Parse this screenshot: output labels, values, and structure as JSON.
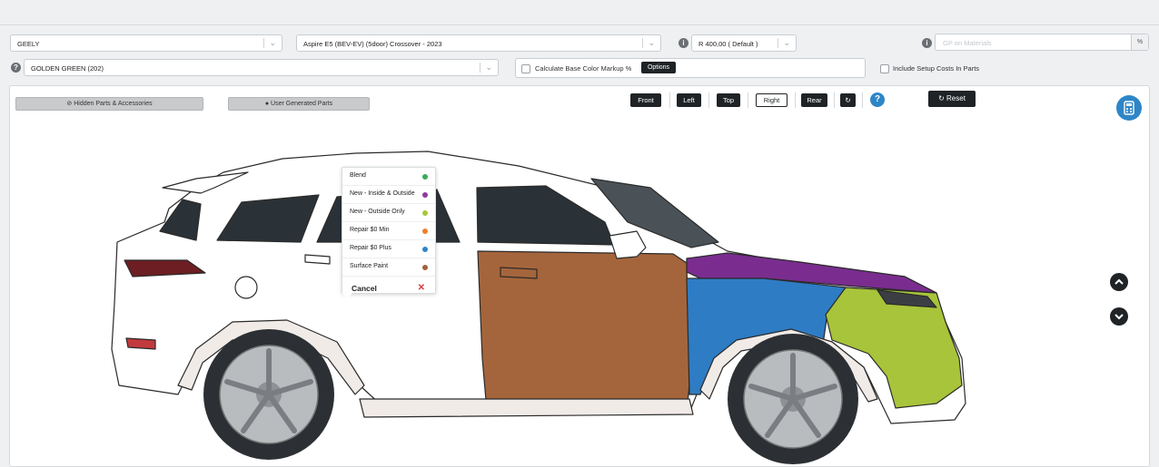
{
  "controls": {
    "make": "GEELY",
    "model": "Aspire E5 (BEV-EV) (5door) Crossover - 2023",
    "rate": "R 400,00 ( Default )",
    "gp_placeholder": "GP on Materials",
    "gp_addon": "%",
    "color": "GOLDEN GREEN (202)",
    "calc_markup_label": "Calculate Base Color Markup %",
    "options_label": "Options",
    "include_setup_label": "Include Setup Costs In Parts",
    "info_glyph": "i",
    "help_glyph": "?"
  },
  "viewer": {
    "hidden_parts_label": "Hidden Parts & Accessories",
    "user_parts_label": "User Generated Parts",
    "views": [
      "Front",
      "Left",
      "Top",
      "Right",
      "Rear"
    ],
    "active_view": "Right",
    "reset_label": "Reset",
    "help_glyph": "?"
  },
  "paint_menu": {
    "items": [
      {
        "label": "Blend",
        "color": "#3aaa5c"
      },
      {
        "label": "New - Inside & Outside",
        "color": "#8e3a9d"
      },
      {
        "label": "New - Outside Only",
        "color": "#a6c93a"
      },
      {
        "label": "Repair $0 Min",
        "color": "#f07f2d"
      },
      {
        "label": "Repair $0 Plus",
        "color": "#2e86c7"
      },
      {
        "label": "Surface Paint",
        "color": "#a0623b"
      }
    ],
    "cancel_label": "Cancel"
  },
  "icons": [
    "chevron-down-icon",
    "info-icon",
    "help-icon",
    "eye-slash-icon",
    "user-icon",
    "refresh-icon",
    "calculator-icon",
    "chevron-up-icon",
    "close-icon"
  ],
  "colors": {
    "accent_blue": "#2e86c7",
    "dark_button": "#1f2326",
    "part_purple": "#7a2d8f",
    "part_blue": "#2e7cc4",
    "part_lime": "#a8c43a",
    "part_brown": "#a5653c"
  }
}
